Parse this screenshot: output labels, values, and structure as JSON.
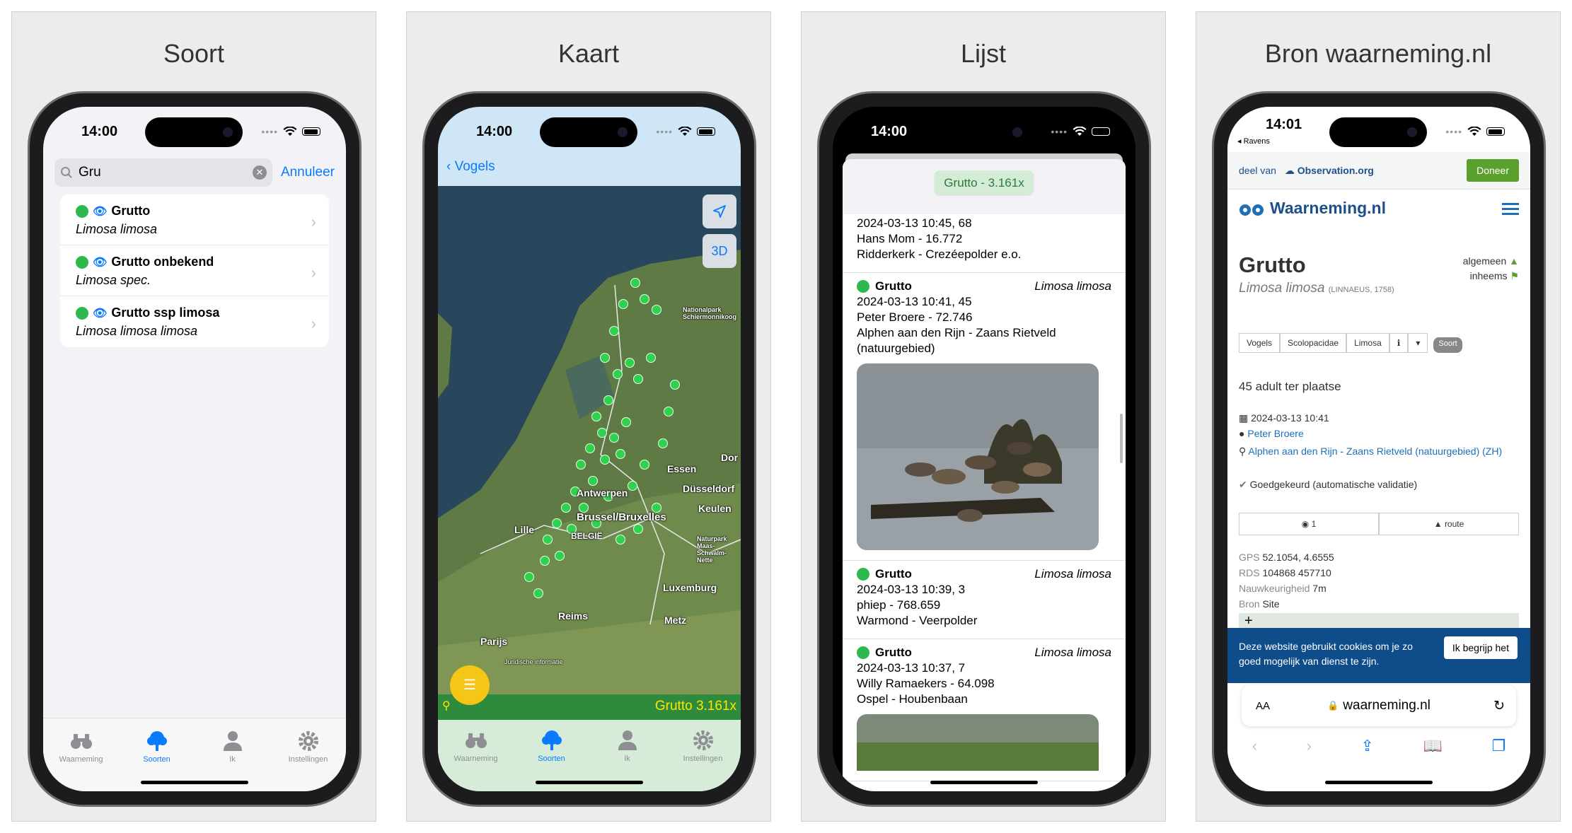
{
  "panels": {
    "soort_title": "Soort",
    "kaart_title": "Kaart",
    "lijst_title": "Lijst",
    "bron_title": "Bron waarneming.nl"
  },
  "status": {
    "time1": "14:00",
    "time2": "14:00",
    "time3": "14:00",
    "time4": "14:01"
  },
  "tabs": [
    "Waarneming",
    "Soorten",
    "Ik",
    "Instellingen"
  ],
  "search": {
    "query": "Gru",
    "cancel": "Annuleer"
  },
  "species": [
    {
      "name": "Grutto",
      "latin": "Limosa limosa"
    },
    {
      "name": "Grutto onbekend",
      "latin": "Limosa spec."
    },
    {
      "name": "Grutto ssp limosa",
      "latin": "Limosa limosa limosa"
    }
  ],
  "map": {
    "back": "Vogels",
    "btn_3d": "3D",
    "footer": "Grutto 3.161x",
    "labels": {
      "antwerpen": "Antwerpen",
      "brussel": "Brussel/Bruxelles",
      "lille": "Lille",
      "belgie": "BELGIË",
      "essen": "Essen",
      "dusseldorf": "Düsseldorf",
      "keulen": "Keulen",
      "luxemburg": "Luxemburg",
      "reims": "Reims",
      "metz": "Metz",
      "parijs": "Parijs",
      "dortmund": "Dor",
      "np_schiermonnikoog": "Nationalpark Schiermonnikoog",
      "np_maas": "Naturpark Maas-Schwalm-Nette",
      "juridische": "Juridische informatie"
    },
    "points": [
      [
        0.65,
        0.18
      ],
      [
        0.68,
        0.21
      ],
      [
        0.72,
        0.23
      ],
      [
        0.61,
        0.22
      ],
      [
        0.58,
        0.27
      ],
      [
        0.55,
        0.32
      ],
      [
        0.59,
        0.35
      ],
      [
        0.63,
        0.33
      ],
      [
        0.66,
        0.36
      ],
      [
        0.7,
        0.32
      ],
      [
        0.56,
        0.4
      ],
      [
        0.52,
        0.43
      ],
      [
        0.54,
        0.46
      ],
      [
        0.5,
        0.49
      ],
      [
        0.47,
        0.52
      ],
      [
        0.51,
        0.55
      ],
      [
        0.55,
        0.51
      ],
      [
        0.58,
        0.47
      ],
      [
        0.62,
        0.44
      ],
      [
        0.6,
        0.5
      ],
      [
        0.45,
        0.57
      ],
      [
        0.42,
        0.6
      ],
      [
        0.39,
        0.63
      ],
      [
        0.36,
        0.66
      ],
      [
        0.4,
        0.69
      ],
      [
        0.44,
        0.64
      ],
      [
        0.48,
        0.6
      ],
      [
        0.52,
        0.63
      ],
      [
        0.56,
        0.58
      ],
      [
        0.64,
        0.56
      ],
      [
        0.68,
        0.52
      ],
      [
        0.74,
        0.48
      ],
      [
        0.76,
        0.42
      ],
      [
        0.78,
        0.37
      ],
      [
        0.72,
        0.6
      ],
      [
        0.66,
        0.64
      ],
      [
        0.6,
        0.66
      ],
      [
        0.35,
        0.7
      ],
      [
        0.3,
        0.73
      ],
      [
        0.33,
        0.76
      ]
    ]
  },
  "lijst": {
    "pill": "Grutto - 3.161x",
    "first": [
      "2024-03-13 10:45, 68",
      "Hans Mom - 16.772",
      "Ridderkerk - Crezéepolder e.o."
    ],
    "observations": [
      {
        "name": "Grutto",
        "latin": "Limosa limosa",
        "lines": [
          "2024-03-13 10:41, 45",
          "Peter Broere - 72.746",
          "Alphen aan den Rijn - Zaans Rietveld",
          "(natuurgebied)"
        ]
      },
      {
        "name": "Grutto",
        "latin": "Limosa limosa",
        "lines": [
          "2024-03-13 10:39, 3",
          "phiep - 768.659",
          "Warmond - Veerpolder"
        ]
      },
      {
        "name": "Grutto",
        "latin": "Limosa limosa",
        "lines": [
          "2024-03-13 10:37, 7",
          "Willy Ramaekers - 64.098",
          "Ospel - Houbenbaan"
        ]
      }
    ]
  },
  "bron": {
    "back_app": "◂ Ravens",
    "deel_van": "deel van",
    "observation_brand": "Observation.org",
    "donate": "Doneer",
    "site_name": "Waarneming.nl",
    "species": "Grutto",
    "latin": "Limosa limosa",
    "author": "(LINNAEUS, 1758)",
    "status1": "algemeen",
    "status2": "inheems",
    "tags": [
      "Vogels",
      "Scolopacidae",
      "Limosa",
      "ℹ",
      "▾"
    ],
    "soort_badge": "Soort",
    "count": "45 adult ter plaatse",
    "date": "2024-03-13 10:41",
    "observer": "Peter Broere",
    "location": "Alphen aan den Rijn - Zaans Rietveld (natuurgebied) (ZH)",
    "validation": "Goedgekeurd (automatische validatie)",
    "photos": "1",
    "route": "route",
    "gps_label": "GPS",
    "gps": "52.1054, 4.6555",
    "rds_label": "RDS",
    "rds": "104868 457710",
    "acc_label": "Nauwkeurigheid",
    "acc": "7m",
    "bron_label": "Bron",
    "bron_val": "Site",
    "cookie_text": "Deze website gebruikt cookies om je zo goed mogelijk van dienst te zijn.",
    "cookie_btn": "Ik begrijp het",
    "url": "waarneming.nl",
    "aa": "AA"
  },
  "colors": {
    "accent": "#0a7aff",
    "green": "#2fb94c",
    "brand": "#1d4f8a",
    "donate": "#5aa02c",
    "cookie_bg": "#0e4c8a"
  }
}
